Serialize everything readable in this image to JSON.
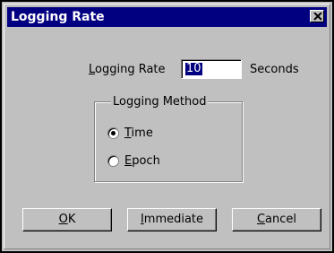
{
  "window": {
    "title": "Logging Rate",
    "close_icon": "close-icon"
  },
  "rate": {
    "label_accel": "L",
    "label_rest": "ogging Rate",
    "value": "10",
    "units": "Seconds"
  },
  "method": {
    "group_title": "Logging Method",
    "options": [
      {
        "accel": "T",
        "rest": "ime",
        "selected": true
      },
      {
        "accel": "E",
        "rest": "poch",
        "selected": false
      }
    ]
  },
  "buttons": {
    "ok_accel": "O",
    "ok_rest": "K",
    "immediate_accel": "I",
    "immediate_rest": "mmediate",
    "cancel_accel": "C",
    "cancel_rest": "ancel"
  }
}
